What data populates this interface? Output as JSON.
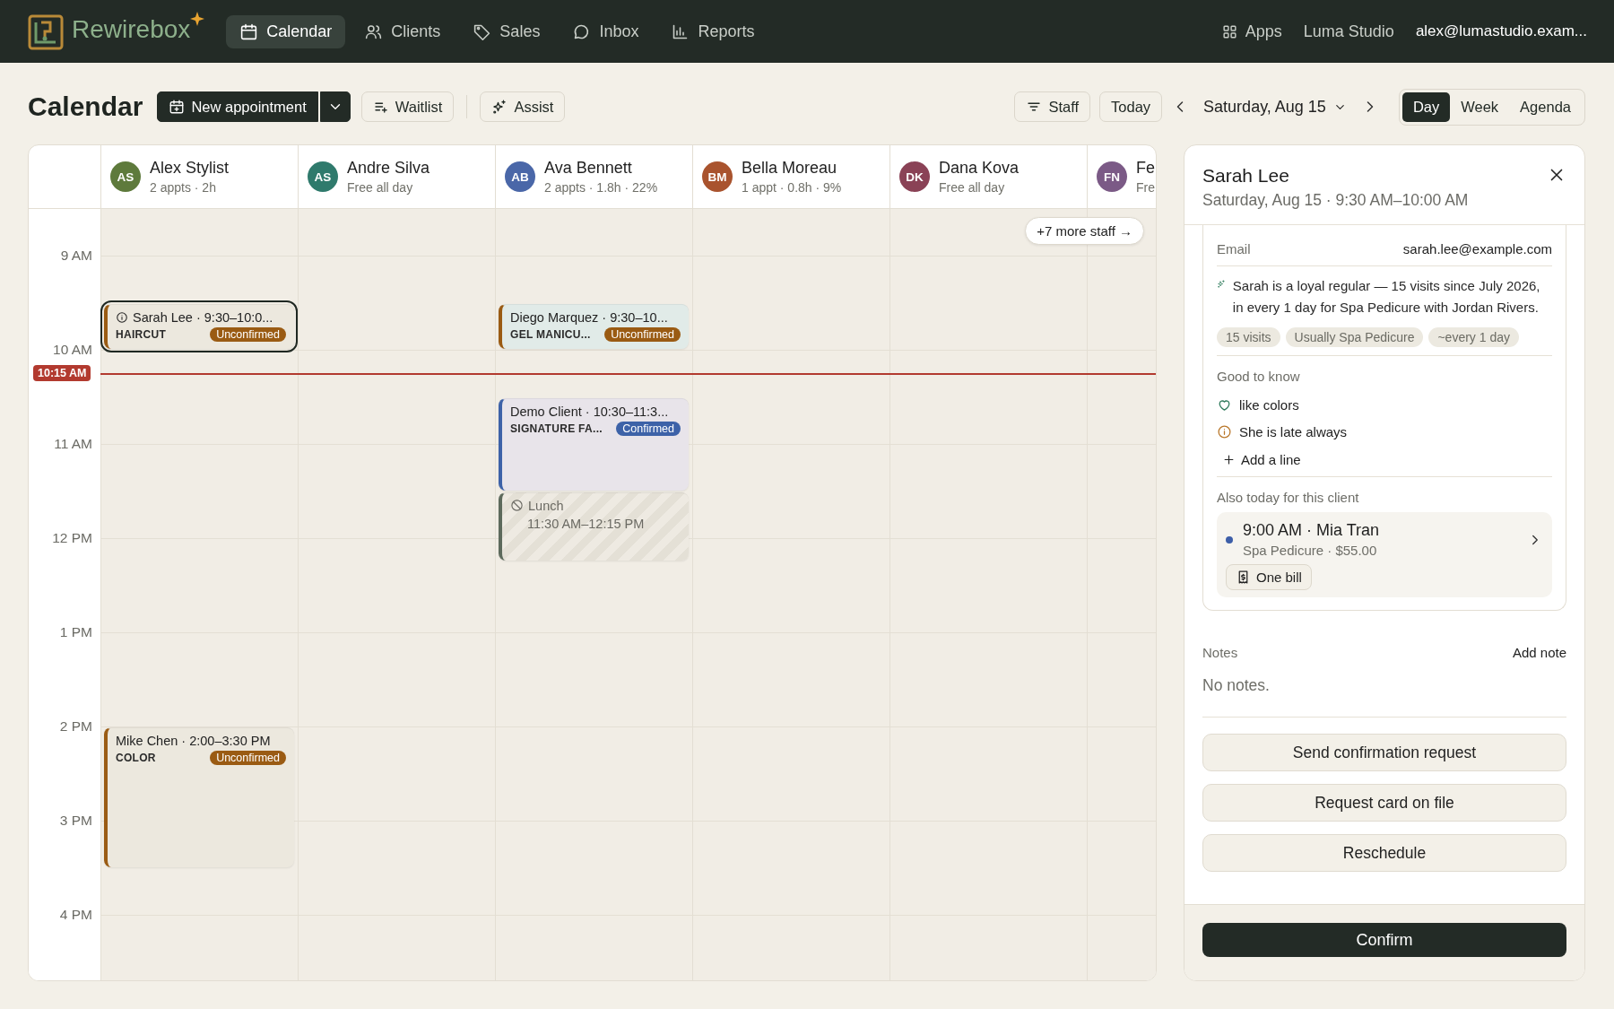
{
  "app": {
    "brand": "Rewirebox"
  },
  "nav": [
    {
      "label": "Calendar",
      "selected": true
    },
    {
      "label": "Clients",
      "selected": false
    },
    {
      "label": "Sales",
      "selected": false
    },
    {
      "label": "Inbox",
      "selected": false
    },
    {
      "label": "Reports",
      "selected": false
    }
  ],
  "account": {
    "apps": "Apps",
    "studio": "Luma Studio",
    "email": "alex@lumastudio.exam..."
  },
  "toolbar": {
    "title": "Calendar",
    "new_appointment": "New appointment",
    "waitlist": "Waitlist",
    "assist": "Assist",
    "staff": "Staff",
    "today": "Today",
    "date": "Saturday, Aug 15",
    "views": [
      {
        "label": "Day",
        "selected": true
      },
      {
        "label": "Week",
        "selected": false
      },
      {
        "label": "Agenda",
        "selected": false
      }
    ]
  },
  "calendar": {
    "hours": [
      "9 AM",
      "10 AM",
      "11 AM",
      "12 PM",
      "1 PM",
      "2 PM",
      "3 PM",
      "4 PM"
    ],
    "now": "10:15 AM",
    "more_staff": "+7 more staff →",
    "staff": [
      {
        "initials": "AS",
        "name": "Alex Stylist",
        "summary": "2 appts · 2h",
        "color": "#5e7a3c",
        "appointments": [
          {
            "kind": "appointment",
            "title": "Sarah Lee · 9:30–10:0...",
            "service": "HAIRCUT",
            "status": "Unconfirmed",
            "confirmed": false,
            "alert": true,
            "selected": true,
            "color": "#ece8de"
          },
          {
            "kind": "appointment",
            "title": "Mike Chen · 2:00–3:30 PM",
            "service": "COLOR",
            "status": "Unconfirmed",
            "confirmed": false,
            "alert": false,
            "selected": false,
            "color": "#ece8de"
          }
        ]
      },
      {
        "initials": "AS",
        "name": "Andre Silva",
        "summary": "Free all day",
        "color": "#2f7a6c"
      },
      {
        "initials": "AB",
        "name": "Ava Bennett",
        "summary": "2 appts · 1.8h · 22%",
        "color": "#4a67a8",
        "appointments": [
          {
            "kind": "appointment",
            "title": "Diego Marquez · 9:30–10...",
            "service": "GEL MANICU...",
            "status": "Unconfirmed",
            "confirmed": false,
            "alert": false,
            "selected": false,
            "color": "#e1ebe8"
          },
          {
            "kind": "appointment",
            "title": "Demo Client · 10:30–11:3...",
            "service": "SIGNATURE FA...",
            "status": "Confirmed",
            "confirmed": true,
            "alert": false,
            "selected": false,
            "color": "#e8e4ea"
          },
          {
            "kind": "block",
            "title": "Lunch",
            "detail": "11:30 AM–12:15 PM"
          }
        ]
      },
      {
        "initials": "BM",
        "name": "Bella Moreau",
        "summary": "1 appt · 0.8h · 9%",
        "color": "#a9532e"
      },
      {
        "initials": "DK",
        "name": "Dana Kova",
        "summary": "Free all day",
        "color": "#8a4256"
      },
      {
        "initials": "FN",
        "name": "Fe",
        "summary": "Fre",
        "color": "#7b5a86"
      }
    ]
  },
  "detail": {
    "title": "Sarah Lee",
    "subtitle": "Saturday, Aug 15 · 9:30 AM–10:00 AM",
    "email_label": "Email",
    "email": "sarah.lee@example.com",
    "insight": "Sarah is a loyal regular — 15 visits since July 2026, in every 1 day for Spa Pedicure with Jordan Rivers.",
    "chips": [
      "15 visits",
      "Usually Spa Pedicure",
      "~every 1 day"
    ],
    "good_to_know": {
      "title": "Good to know",
      "items": [
        {
          "kind": "like",
          "text": "like colors"
        },
        {
          "kind": "warning",
          "text": "She is late always"
        }
      ],
      "add": "Add a line"
    },
    "also_today": {
      "title": "Also today for this client",
      "items": [
        {
          "heading": "9:00 AM · Mia Tran",
          "detail": "Spa Pedicure · $55.00",
          "color": "#3d5ea8",
          "bill": "One bill"
        }
      ]
    },
    "notes": {
      "title": "Notes",
      "action": "Add note",
      "empty": "No notes."
    },
    "actions": [
      "Send confirmation request",
      "Request card on file",
      "Reschedule"
    ],
    "primary": "Confirm"
  }
}
